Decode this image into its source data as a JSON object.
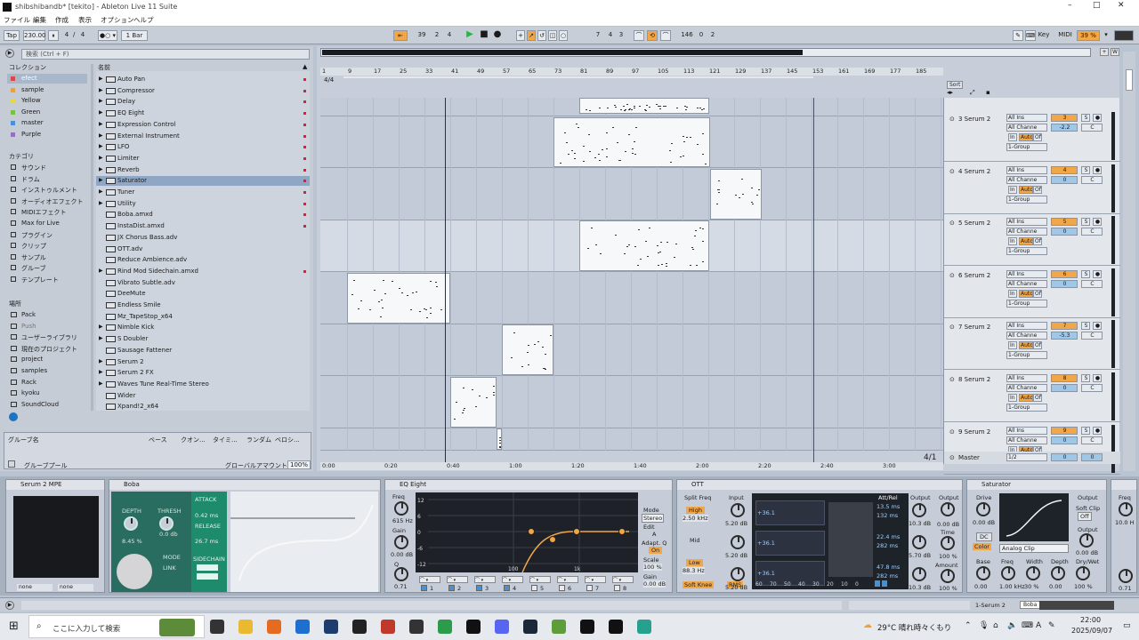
{
  "window": {
    "title": "shibshibandb* [tekito] - Ableton Live 11 Suite"
  },
  "menu": [
    "ファイル",
    "編集",
    "作成",
    "表示",
    "オプション",
    "ヘルプ"
  ],
  "transport": {
    "tap": "Tap",
    "tempo": "230.00",
    "sig_num": "4",
    "sig_den": "4",
    "quant": "1 Bar",
    "position": [
      "39",
      "2",
      "4"
    ],
    "loop_start": [
      "7",
      "4",
      "3"
    ],
    "loop_len": [
      "146",
      "0",
      "2"
    ],
    "key": "Key",
    "midi": "MIDI",
    "cpu": "39 %"
  },
  "browser": {
    "search_placeholder": "検索 (Ctrl + F)",
    "collections_header": "コレクション",
    "collections": [
      {
        "label": "efect",
        "color": "#d84a4a"
      },
      {
        "label": "sample",
        "color": "#f0a030"
      },
      {
        "label": "Yellow",
        "color": "#e9d93f"
      },
      {
        "label": "Green",
        "color": "#79c04a"
      },
      {
        "label": "master",
        "color": "#4b8fd8"
      },
      {
        "label": "Purple",
        "color": "#9a6ad0"
      }
    ],
    "categories_header": "カテゴリ",
    "categories": [
      "サウンド",
      "ドラム",
      "インストゥルメント",
      "オーディオエフェクト",
      "MIDIエフェクト",
      "Max for Live",
      "プラグイン",
      "クリップ",
      "サンプル",
      "グルーブ",
      "テンプレート"
    ],
    "places_header": "場所",
    "places": [
      "Pack",
      "Push",
      "ユーザーライブラリ",
      "現在のプロジェクト",
      "project",
      "samples",
      "Rack",
      "kyoku",
      "SoundCloud"
    ],
    "name_header": "名前",
    "items": [
      "Auto Pan",
      "Compressor",
      "Delay",
      "EQ Eight",
      "Expression Control",
      "External Instrument",
      "LFO",
      "Limiter",
      "Reverb",
      "Saturator",
      "Tuner",
      "Utility",
      "Boba.amxd",
      "InstaDist.amxd",
      "JX Chorus Bass.adv",
      "OTT.adv",
      "Reduce Ambience.adv",
      "Rind Mod Sidechain.amxd",
      "Vibrato Subtle.adv",
      "DeeMute",
      "Endless Smile",
      "Mz_TapeStop_x64",
      "Nimble Kick",
      "S Doubler",
      "Sausage Fattener",
      "Serum 2",
      "Serum 2 FX",
      "Waves Tune Real-Time Stereo",
      "Wider",
      "Xpand!2_x64"
    ],
    "selected": "Saturator",
    "groove_cols": [
      "グルーブ名",
      "ベース",
      "クオン...",
      "タイミ...",
      "ランダム",
      "ベロシ..."
    ],
    "groove_pool": "グルーブプール",
    "global_amount_label": "グローバルアマウント",
    "global_amount": "100%"
  },
  "arrangement": {
    "bars": [
      "1",
      "9",
      "17",
      "25",
      "33",
      "41",
      "49",
      "57",
      "65",
      "73",
      "81",
      "89",
      "97",
      "105",
      "113",
      "121",
      "129",
      "137",
      "145",
      "153",
      "161",
      "169",
      "177",
      "185"
    ],
    "sig_marker": "4/4",
    "times": [
      "0:00",
      "0:20",
      "0:40",
      "1:00",
      "1:20",
      "1:40",
      "2:00",
      "2:20",
      "2:40",
      "3:00"
    ],
    "scale_label": "4/1"
  },
  "mixer": {
    "sort": "Sort",
    "tracks": [
      {
        "name": "3 Serum 2",
        "num": "3",
        "vol": "-2.2",
        "pan": "C"
      },
      {
        "name": "4 Serum 2",
        "num": "4",
        "vol": "0",
        "pan": "C"
      },
      {
        "name": "5 Serum 2",
        "num": "5",
        "vol": "0",
        "pan": "C"
      },
      {
        "name": "6 Serum 2",
        "num": "6",
        "vol": "0",
        "pan": "C"
      },
      {
        "name": "7 Serum 2",
        "num": "7",
        "vol": "-5.3",
        "pan": "C"
      },
      {
        "name": "8 Serum 2",
        "num": "8",
        "vol": "0",
        "pan": "C"
      },
      {
        "name": "9 Serum 2",
        "num": "9",
        "vol": "0",
        "pan": "C"
      }
    ],
    "input_type": "All Ins",
    "input_channel": "All Channe",
    "mon": [
      "In",
      "Auto",
      "Off"
    ],
    "output": "1-Group",
    "master": {
      "name": "Master",
      "out": "1/2",
      "vol": "0",
      "pan": "0"
    }
  },
  "devices": {
    "serum": {
      "title": "Serum 2 MPE",
      "none1": "none",
      "none2": "none"
    },
    "boba": {
      "title": "Boba",
      "depth_label": "DEPTH",
      "depth": "8.45 %",
      "thresh_label": "THRESH",
      "thresh": "0.0 db",
      "mode_label": "MODE",
      "mode": "LINK",
      "attack_label": "ATTACK",
      "attack": "0.42 ms",
      "release_label": "RELEASE",
      "release": "26.7 ms",
      "sidechain_label": "SIDECHAIN"
    },
    "eq": {
      "title": "EQ Eight",
      "freq_label": "Freq",
      "freq": "615 Hz",
      "gain_label": "Gain",
      "gain": "0.00 dB",
      "q_label": "Q",
      "q": "0.71",
      "db_ticks": [
        "12",
        "6",
        "0",
        "-6",
        "-12"
      ],
      "freq_ticks": [
        "100",
        "1k",
        "10k"
      ],
      "mode_label": "Mode",
      "mode": "Stereo",
      "edit_label": "Edit",
      "edit": "A",
      "adapt_label": "Adapt. Q",
      "adapt": "On",
      "scale_label": "Scale",
      "scale": "100 %",
      "gain_out_label": "Gain",
      "gain_out": "0.00 dB",
      "bands": [
        "1",
        "2",
        "3",
        "4",
        "5",
        "6",
        "7",
        "8"
      ]
    },
    "ott": {
      "title": "OTT",
      "split_label": "Split Freq",
      "high_label": "High",
      "high": "2.50 kHz",
      "mid_label": "Mid",
      "low_label": "Low",
      "low": "88.3 Hz",
      "soft_knee": "Soft Knee",
      "rms": "RMS",
      "input_label": "Input",
      "inputs": [
        "5.20 dB",
        "5.20 dB",
        "5.20 dB"
      ],
      "ratios": [
        "+36.1",
        "+36.1",
        "+36.1"
      ],
      "attrel_label": "Att/Rel",
      "attrel": [
        "13.5 ms",
        "132 ms",
        "22.4 ms",
        "282 ms",
        "47.8 ms",
        "282 ms"
      ],
      "output_label": "Output",
      "outputs": [
        "10.3 dB",
        "5.70 dB",
        "10.3 dB"
      ],
      "out_label": "Output",
      "out": "0.00 dB",
      "time_label": "Time",
      "time": "100 %",
      "amount_label": "Amount",
      "amount": "100 %",
      "meter_ticks": [
        "60",
        "70",
        "50",
        "40",
        "30",
        "20",
        "10",
        "0"
      ]
    },
    "sat": {
      "title": "Saturator",
      "drive_label": "Drive",
      "drive": "0.00 dB",
      "dc": "DC",
      "color": "Color",
      "type": "Analog Clip",
      "output_label": "Output",
      "soft_clip": "Soft Clip",
      "soft_clip_state": "Off",
      "output": "0.00 dB",
      "base_label": "Base",
      "base": "0.00",
      "freq_label": "Freq",
      "freq": "1.00 kHz",
      "width_label": "Width",
      "width": "30 %",
      "depth_label": "Depth",
      "depth": "0.00",
      "drywet_label": "Dry/Wet",
      "drywet": "100 %"
    },
    "next": {
      "freq_label": "Freq",
      "freq": "10.0 H",
      "q": "0.71"
    }
  },
  "statusbar": {
    "track_label": "1-Serum 2",
    "device": "Boba"
  },
  "taskbar": {
    "search": "ここに入力して検索",
    "weather": "29°C 晴れ時々くもり",
    "time": "22:00",
    "date": "2025/09/07",
    "lang": "A"
  }
}
